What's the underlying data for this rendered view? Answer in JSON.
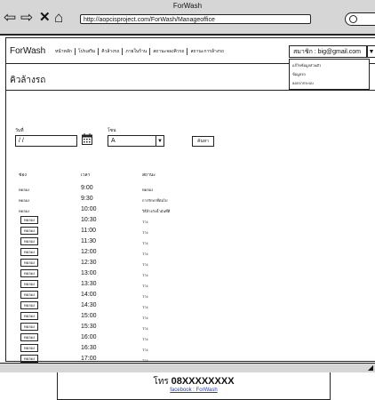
{
  "browser": {
    "window_title": "ForWash",
    "url": "http://aopcisproject.com/ForWash/Manageoffice"
  },
  "header": {
    "brand": "ForWash",
    "menu": [
      "หน้าหลัก",
      "โปรเสริม",
      "คิวล้างรถ",
      "ภายในร้าน",
      "สถานะจองคิวรถ",
      "สถานะการล้างรถ"
    ],
    "account_label": "สมาชิก : big@gmail.com",
    "account_menu": [
      "แก้ไขข้อมูลส่วนตัว",
      "ข้อมูลรถ",
      "ออกจากระบบ"
    ]
  },
  "page": {
    "title": "คิวล้างรถ"
  },
  "filters": {
    "date_label": "วันที่",
    "date_value": "/ /",
    "zone_label": "โซน",
    "zone_value": "A",
    "search_label": "ค้นหา"
  },
  "table": {
    "headers": [
      "ช่อง",
      "เวลา",
      "สถานะ"
    ],
    "rows": [
      {
        "slot": "ทดลอง",
        "time": "9:00",
        "status": "ทดลอง"
      },
      {
        "slot": "ทดลอง",
        "time": "9:30",
        "status": "การรักษาที่ต่อไป"
      },
      {
        "slot": "ทดลอง",
        "time": "10:00",
        "status": "วิธีล้างถังน้ำมันที่ดี"
      },
      {
        "slot": "ทดลอง",
        "time": "10:30",
        "status": "ว่าง"
      },
      {
        "slot": "ทดลอง",
        "time": "11:00",
        "status": "ว่าง"
      },
      {
        "slot": "ทดลอง",
        "time": "11:30",
        "status": "ว่าง"
      },
      {
        "slot": "ทดลอง",
        "time": "12:00",
        "status": "ว่าง"
      },
      {
        "slot": "ทดลอง",
        "time": "12:30",
        "status": "ว่าง"
      },
      {
        "slot": "ทดลอง",
        "time": "13:00",
        "status": "ว่าง"
      },
      {
        "slot": "ทดลอง",
        "time": "13:30",
        "status": "ว่าง"
      },
      {
        "slot": "ทดลอง",
        "time": "14:00",
        "status": "ว่าง"
      },
      {
        "slot": "ทดลอง",
        "time": "14:30",
        "status": "ว่าง"
      },
      {
        "slot": "ทดลอง",
        "time": "15:00",
        "status": "ว่าง"
      },
      {
        "slot": "ทดลอง",
        "time": "15:30",
        "status": "ว่าง"
      },
      {
        "slot": "ทดลอง",
        "time": "16:00",
        "status": "ว่าง"
      },
      {
        "slot": "ทดลอง",
        "time": "16:30",
        "status": "ว่าง"
      },
      {
        "slot": "ทดลอง",
        "time": "17:00",
        "status": "ว่าง"
      }
    ]
  },
  "footer": {
    "phone_prefix": "โทร",
    "phone_number": "08XXXXXXXX",
    "facebook": "facebook : ForWash"
  }
}
